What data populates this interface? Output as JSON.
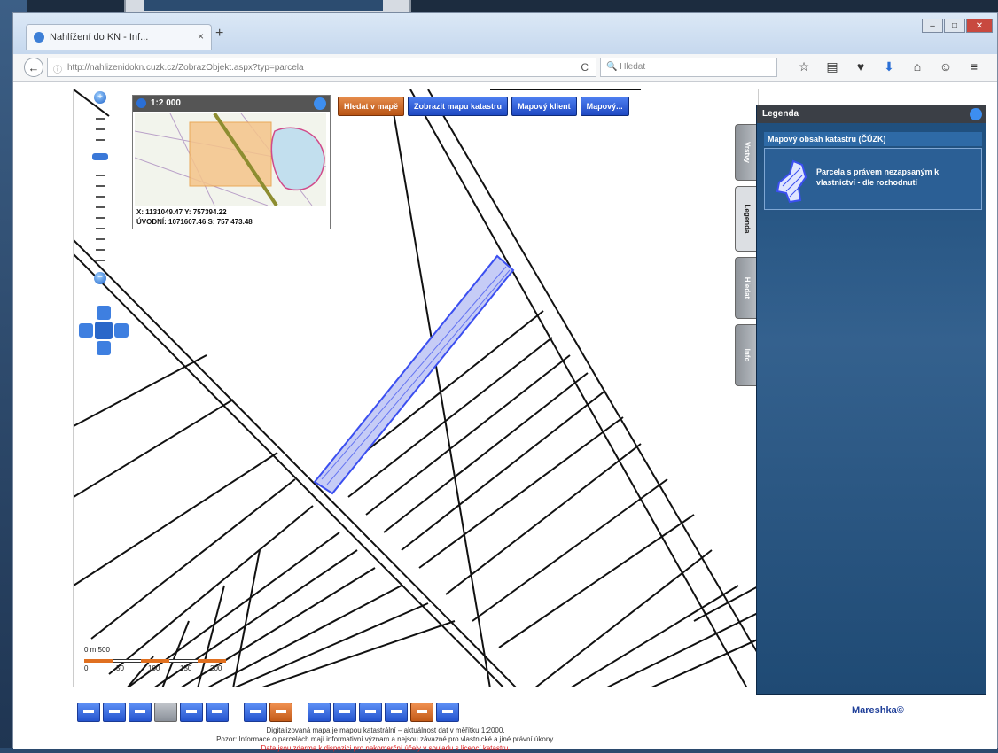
{
  "browser": {
    "tab_title": "Nahlížení do KN - Inf...",
    "tab_close": "×",
    "new_tab": "+",
    "url": "http://nahlizenidokn.cuzk.cz/ZobrazObjekt.aspx?typ=parcela",
    "reload": "C",
    "search_placeholder": "Hledat",
    "window_minimize": "–",
    "window_maximize": "□",
    "window_close": "✕"
  },
  "map": {
    "scale_label": "1:2 000",
    "overview": {
      "coords_line1": "X: 1131049.47   Y: 757394.22",
      "coords_line2": "ÚVODNÍ: 1071607.46   S: 757 473.48"
    },
    "top_buttons": [
      "Hledat v mapě",
      "Zobrazit mapu katastru",
      "Mapový klient",
      "Mapový..."
    ],
    "scalebar": {
      "label": "0 m 500",
      "ticks": [
        "0",
        "50",
        "100",
        "150",
        "200"
      ]
    }
  },
  "legend": {
    "title": "Legenda",
    "section": "Mapový obsah katastru (ČÚZK)",
    "item_text": "Parcela s právem nezapsaným k vlastnictví - dle rozhodnutí",
    "tabs": [
      "Vrstvy",
      "Legenda",
      "Hledat",
      "Info"
    ]
  },
  "toolbar": {
    "brand": "Mareshka©"
  },
  "footer": {
    "line1": "Digitalizovaná mapa je mapou katastrální – aktuálnost dat v měřítku 1:2000.",
    "line2": "Pozor: Informace o parcelách mají informativní význam a nejsou závazné pro vlastnické a jiné právní úkony.",
    "line3": "Data jsou zdarma k dispozici pro nekomerční účely v souladu s licencí katastru."
  },
  "colors": {
    "accent_blue": "#2453cd",
    "orange_button": "#c25a18",
    "legend_panel": "#2b5f95",
    "highlight_parcel": "#3b4ff0"
  }
}
